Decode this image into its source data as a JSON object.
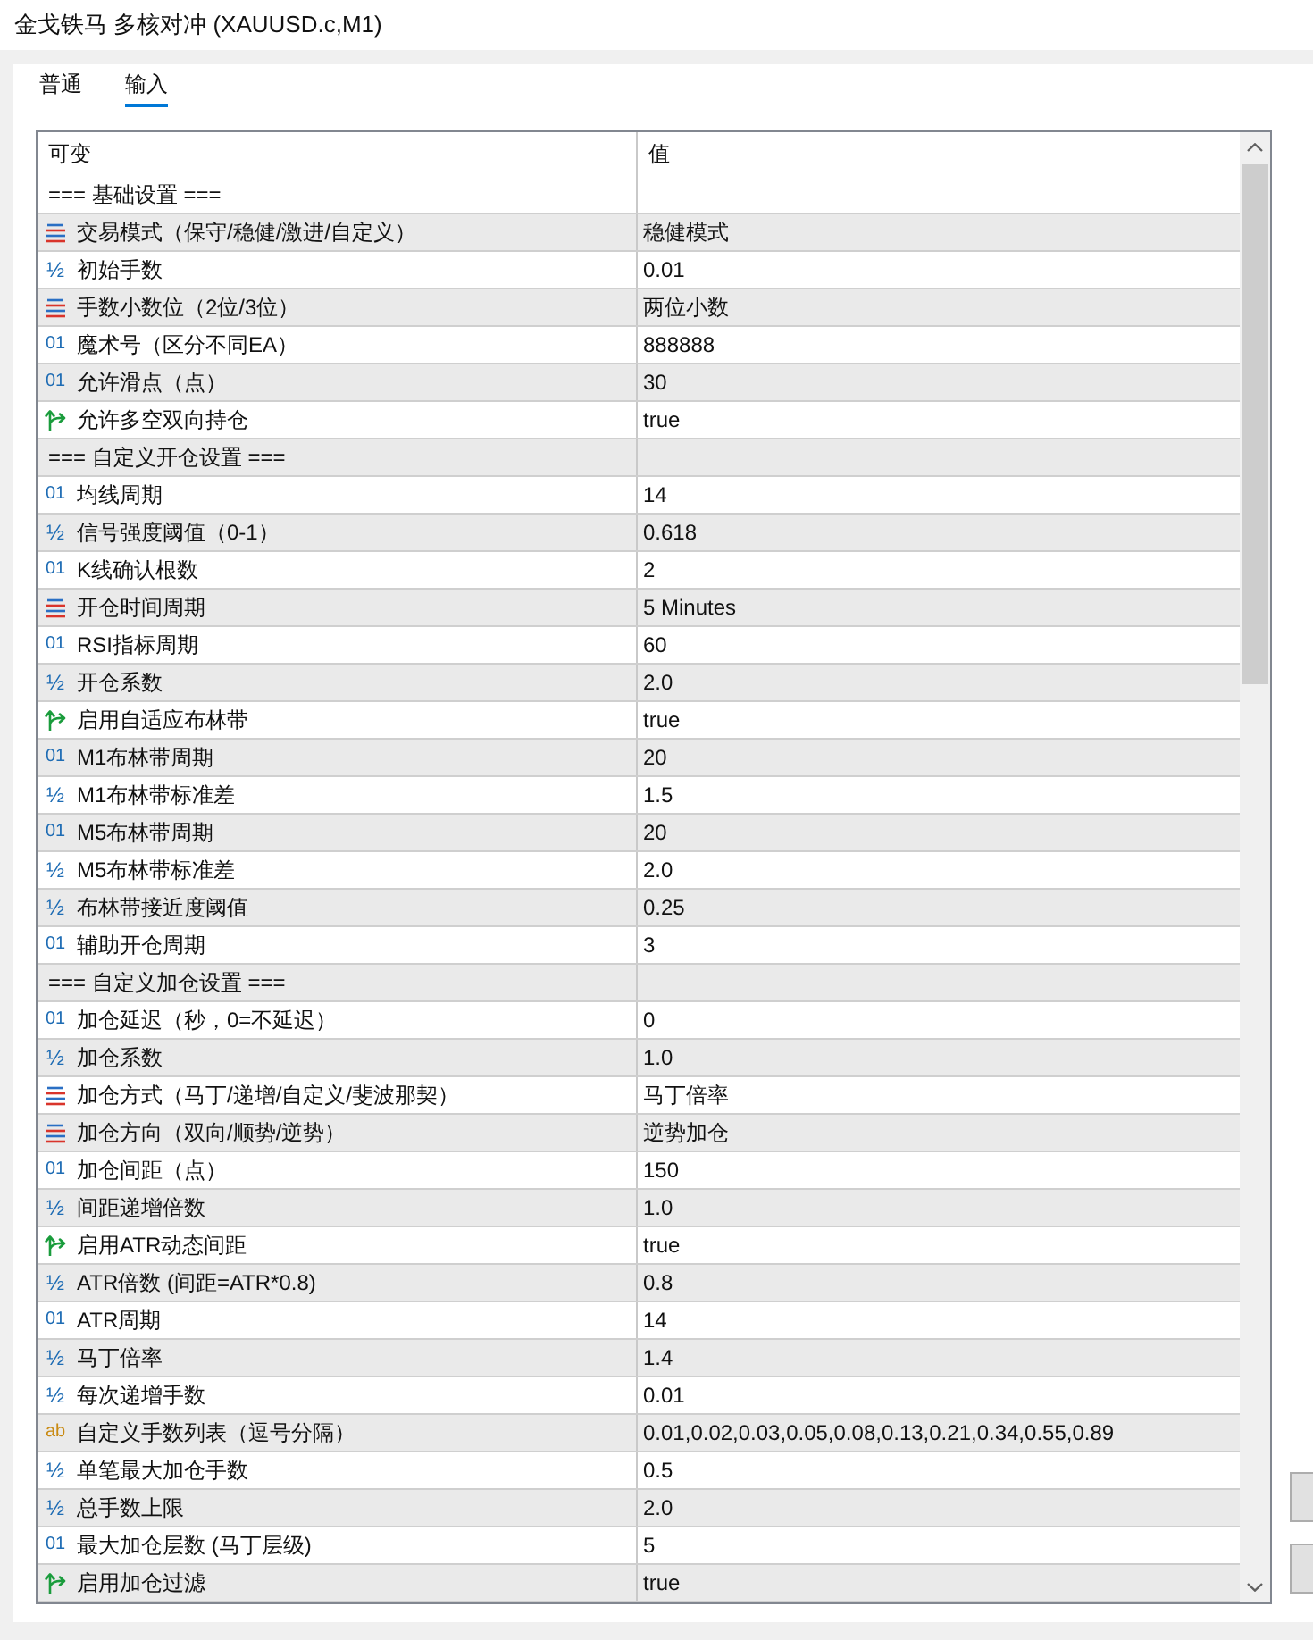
{
  "window": {
    "title": "金戈铁马 多核对冲 (XAUUSD.c,M1)"
  },
  "tabs": [
    {
      "label": "普通",
      "selected": false
    },
    {
      "label": "输入",
      "selected": true
    }
  ],
  "table": {
    "columns": [
      "可变",
      "值"
    ],
    "rows": [
      {
        "kind": "section",
        "name": "=== 基础设置 ==="
      },
      {
        "kind": "enum",
        "name": "交易模式（保守/稳健/激进/自定义）",
        "value": "稳健模式"
      },
      {
        "kind": "double",
        "mark": "½",
        "name": "初始手数",
        "value": "0.01"
      },
      {
        "kind": "enum",
        "name": "手数小数位（2位/3位）",
        "value": "两位小数"
      },
      {
        "kind": "int",
        "mark": "01",
        "name": "魔术号（区分不同EA）",
        "value": "888888"
      },
      {
        "kind": "int",
        "mark": "01",
        "name": "允许滑点（点）",
        "value": "30"
      },
      {
        "kind": "bool",
        "name": "允许多空双向持仓",
        "value": "true"
      },
      {
        "kind": "section",
        "name": "=== 自定义开仓设置 ==="
      },
      {
        "kind": "int",
        "mark": "01",
        "name": "均线周期",
        "value": "14"
      },
      {
        "kind": "double",
        "mark": "½",
        "name": "信号强度阈值（0-1）",
        "value": "0.618"
      },
      {
        "kind": "int",
        "mark": "01",
        "name": "K线确认根数",
        "value": "2"
      },
      {
        "kind": "enum",
        "name": "开仓时间周期",
        "value": "5 Minutes"
      },
      {
        "kind": "int",
        "mark": "01",
        "name": "RSI指标周期",
        "value": "60"
      },
      {
        "kind": "double",
        "mark": "½",
        "name": "开仓系数",
        "value": "2.0"
      },
      {
        "kind": "bool",
        "name": "启用自适应布林带",
        "value": "true"
      },
      {
        "kind": "int",
        "mark": "01",
        "name": "M1布林带周期",
        "value": "20"
      },
      {
        "kind": "double",
        "mark": "½",
        "name": "M1布林带标准差",
        "value": "1.5"
      },
      {
        "kind": "int",
        "mark": "01",
        "name": "M5布林带周期",
        "value": "20"
      },
      {
        "kind": "double",
        "mark": "½",
        "name": "M5布林带标准差",
        "value": "2.0"
      },
      {
        "kind": "double",
        "mark": "½",
        "name": "布林带接近度阈值",
        "value": "0.25"
      },
      {
        "kind": "int",
        "mark": "01",
        "name": "辅助开仓周期",
        "value": "3"
      },
      {
        "kind": "section",
        "name": "=== 自定义加仓设置 ==="
      },
      {
        "kind": "int",
        "mark": "01",
        "name": "加仓延迟（秒，0=不延迟）",
        "value": "0"
      },
      {
        "kind": "double",
        "mark": "½",
        "name": "加仓系数",
        "value": "1.0"
      },
      {
        "kind": "enum",
        "name": "加仓方式（马丁/递增/自定义/斐波那契）",
        "value": "马丁倍率"
      },
      {
        "kind": "enum",
        "name": "加仓方向（双向/顺势/逆势）",
        "value": "逆势加仓"
      },
      {
        "kind": "int",
        "mark": "01",
        "name": "加仓间距（点）",
        "value": "150"
      },
      {
        "kind": "double",
        "mark": "½",
        "name": "间距递增倍数",
        "value": "1.0"
      },
      {
        "kind": "bool",
        "name": "启用ATR动态间距",
        "value": "true"
      },
      {
        "kind": "double",
        "mark": "½",
        "name": "ATR倍数 (间距=ATR*0.8)",
        "value": "0.8"
      },
      {
        "kind": "int",
        "mark": "01",
        "name": "ATR周期",
        "value": "14"
      },
      {
        "kind": "double",
        "mark": "½",
        "name": "马丁倍率",
        "value": "1.4"
      },
      {
        "kind": "double",
        "mark": "½",
        "name": "每次递增手数",
        "value": "0.01"
      },
      {
        "kind": "string",
        "mark": "ab",
        "name": "自定义手数列表（逗号分隔）",
        "value": "0.01,0.02,0.03,0.05,0.08,0.13,0.21,0.34,0.55,0.89"
      },
      {
        "kind": "double",
        "mark": "½",
        "name": "单笔最大加仓手数",
        "value": "0.5"
      },
      {
        "kind": "double",
        "mark": "½",
        "name": "总手数上限",
        "value": "2.0"
      },
      {
        "kind": "int",
        "mark": "01",
        "name": "最大加仓层数 (马丁层级)",
        "value": "5"
      },
      {
        "kind": "bool",
        "name": "启用加仓过滤",
        "value": "true"
      }
    ]
  }
}
